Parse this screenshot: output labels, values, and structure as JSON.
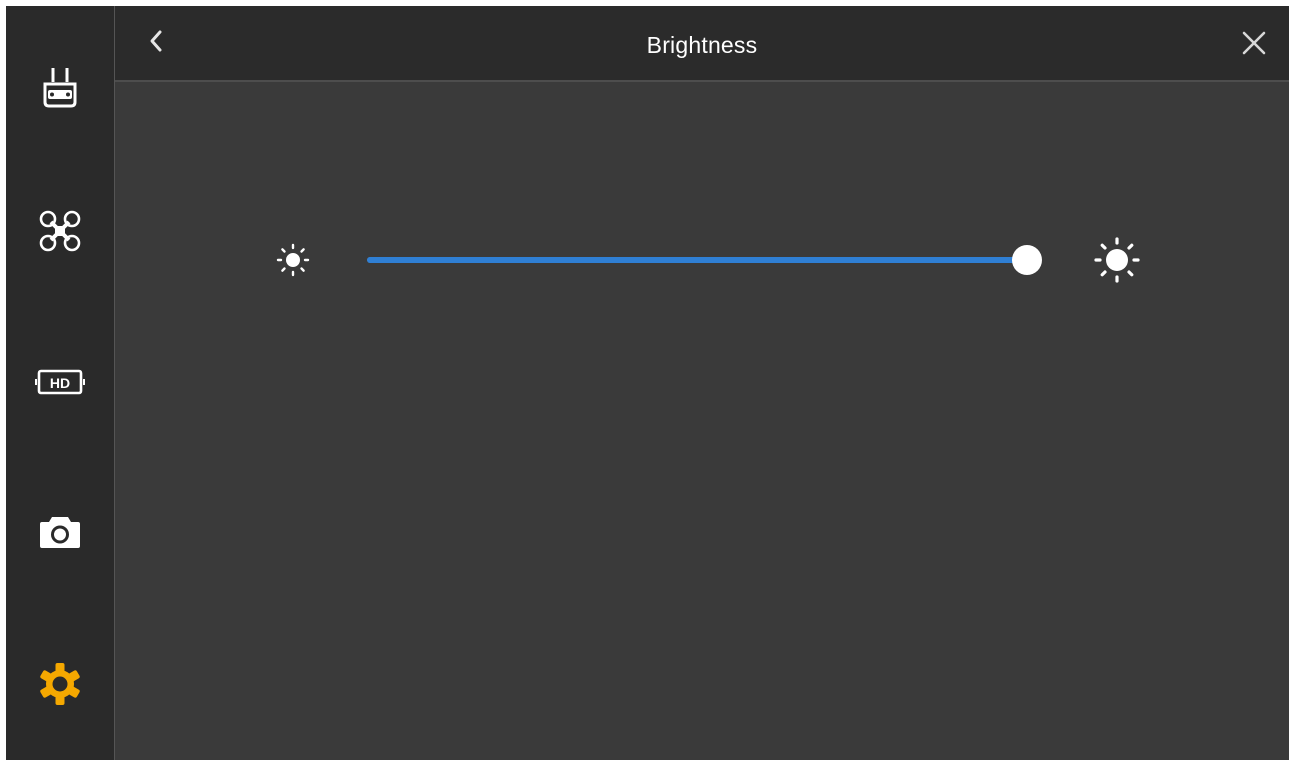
{
  "header": {
    "title": "Brightness"
  },
  "sidebar": {
    "items": [
      {
        "name": "remote-controller",
        "icon": "remote-controller-icon",
        "active": false
      },
      {
        "name": "aircraft",
        "icon": "drone-icon",
        "active": false
      },
      {
        "name": "hd-transmission",
        "icon": "hd-icon",
        "active": false
      },
      {
        "name": "camera",
        "icon": "camera-icon",
        "active": false
      },
      {
        "name": "settings",
        "icon": "gear-icon",
        "active": true
      }
    ]
  },
  "brightness": {
    "level": 1.0,
    "min_icon": "sun-small-icon",
    "max_icon": "sun-large-icon"
  },
  "colors": {
    "accent": "#2f7fd4",
    "active_icon": "#f5a800",
    "icon": "#ffffff"
  }
}
